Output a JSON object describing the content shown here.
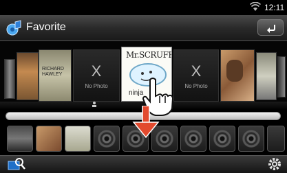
{
  "status_bar": {
    "time": "12:11",
    "wifi_icon": "wifi-icon"
  },
  "title_bar": {
    "title": "Favorite",
    "icon": "audio-source-icon",
    "back_icon": "return-icon"
  },
  "coverflow": {
    "covers": [
      {
        "kind": "art",
        "text": ""
      },
      {
        "kind": "art",
        "text": ""
      },
      {
        "kind": "art",
        "text": "RICHARD HAWLEY"
      },
      {
        "kind": "noimg",
        "x": "X",
        "label": "No Photo"
      },
      {
        "kind": "art",
        "text": "Mr.SCRUFF"
      },
      {
        "kind": "noimg",
        "x": "X",
        "label": "No Photo"
      },
      {
        "kind": "art",
        "text": ""
      },
      {
        "kind": "art",
        "text": ""
      }
    ],
    "selected_index": 4,
    "selected_title": "Mr.SCRUFF",
    "selected_subtitle": "ninja"
  },
  "thumb_strip": {
    "filled": 3,
    "empty": 9
  },
  "bottom_bar": {
    "left_icon": "search-list-icon",
    "right_icon": "settings-icon"
  },
  "overlays": {
    "hand": "touch-hand-icon",
    "arrow": "down-arrow-icon"
  }
}
